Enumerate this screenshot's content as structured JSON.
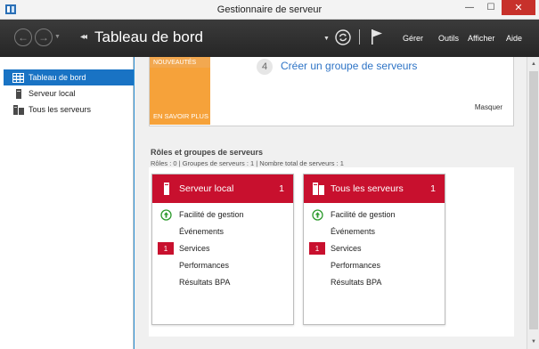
{
  "window": {
    "title": "Gestionnaire de serveur",
    "minimize_glyph": "—",
    "maximize_glyph": "☐",
    "close_glyph": "✕"
  },
  "toolbar": {
    "back_glyph": "←",
    "forward_glyph": "→",
    "dropdown_glyph": "▼",
    "breadcrumb_arrows": "◂◂",
    "breadcrumb_title": "Tableau de bord",
    "menu": [
      "Gérer",
      "Outils",
      "Afficher",
      "Aide"
    ]
  },
  "sidebar": {
    "items": [
      {
        "label": "Tableau de bord",
        "icon": "dashboard-icon"
      },
      {
        "label": "Serveur local",
        "icon": "server-icon"
      },
      {
        "label": "Tous les serveurs",
        "icon": "servers-icon"
      }
    ]
  },
  "welcome": {
    "tile_top": "NOUVEAUTÉS",
    "tile_bottom": "EN SAVOIR PLUS",
    "step_number": "4",
    "step_link": "Créer un groupe de serveurs",
    "hide_label": "Masquer"
  },
  "roles": {
    "heading": "Rôles et groupes de serveurs",
    "stats": "Rôles : 0   |   Groupes de serveurs : 1   |   Nombre total de serveurs : 1"
  },
  "tiles": [
    {
      "title": "Serveur local",
      "count": "1",
      "rows": [
        {
          "label": "Facilité de gestion",
          "status": "ok"
        },
        {
          "label": "Événements",
          "status": ""
        },
        {
          "label": "Services",
          "status": "alert",
          "badge": "1"
        },
        {
          "label": "Performances",
          "status": ""
        },
        {
          "label": "Résultats BPA",
          "status": ""
        }
      ]
    },
    {
      "title": "Tous les serveurs",
      "count": "1",
      "rows": [
        {
          "label": "Facilité de gestion",
          "status": "ok"
        },
        {
          "label": "Événements",
          "status": ""
        },
        {
          "label": "Services",
          "status": "alert",
          "badge": "1"
        },
        {
          "label": "Performances",
          "status": ""
        },
        {
          "label": "Résultats BPA",
          "status": ""
        }
      ]
    }
  ],
  "colors": {
    "accent_blue": "#1973c4",
    "tile_red": "#c8102e",
    "welcome_orange": "#f6a23a",
    "ok_green": "#2e9b2e"
  }
}
